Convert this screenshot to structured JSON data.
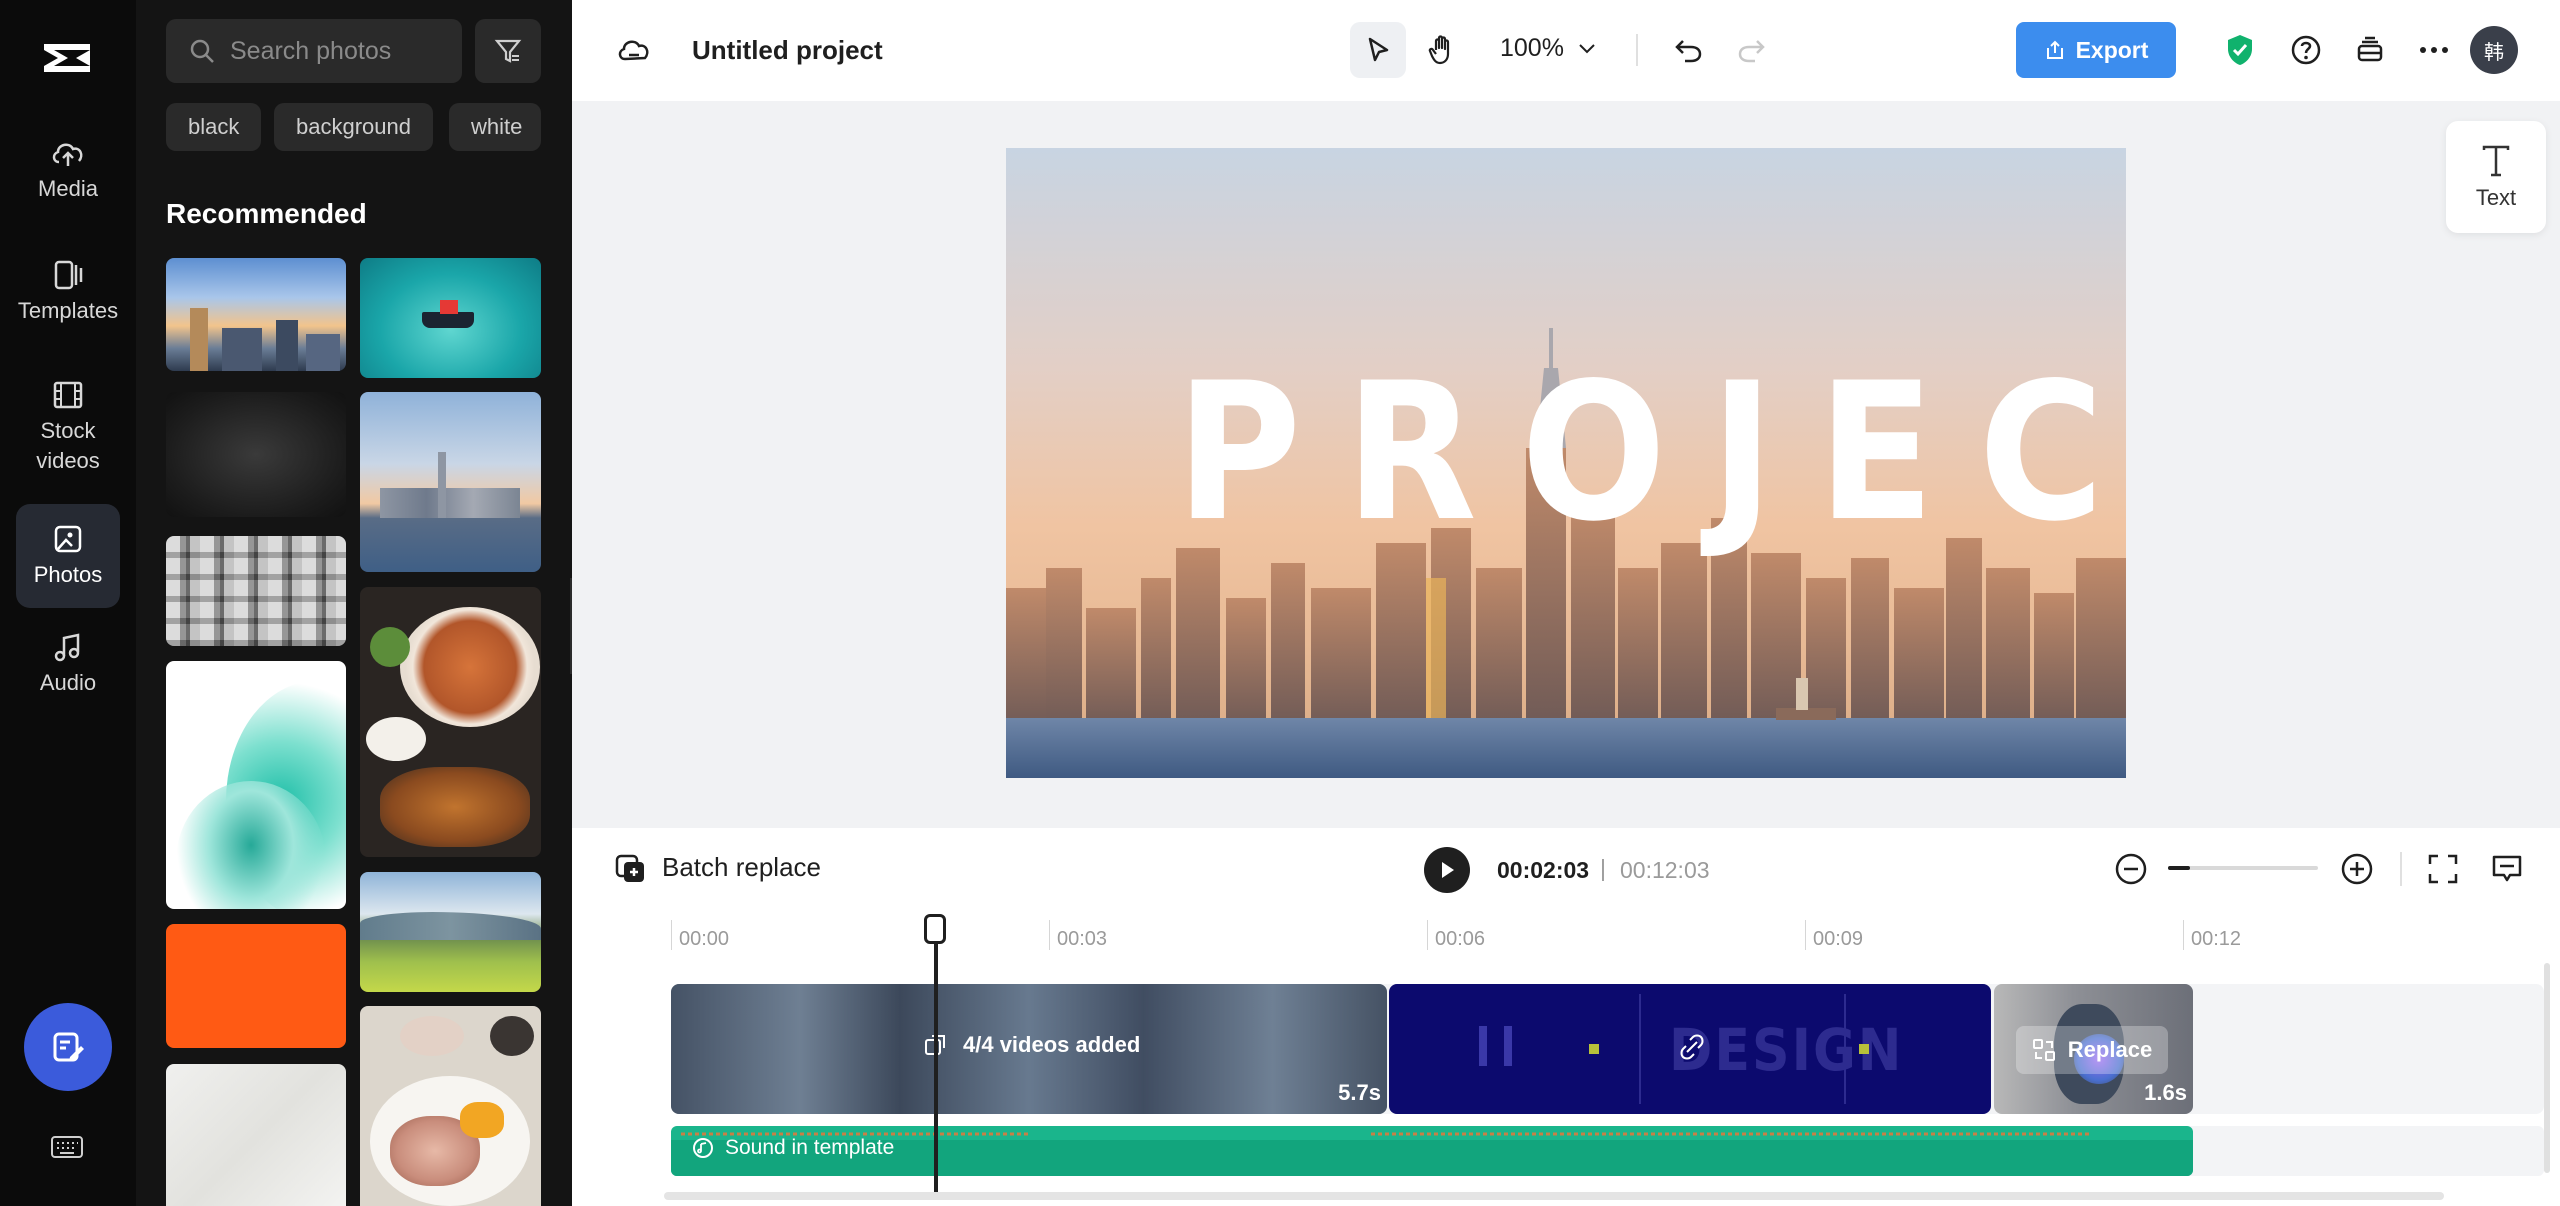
{
  "nav": {
    "items": [
      {
        "label": "Media",
        "icon": "cloud-upload-icon"
      },
      {
        "label": "Templates",
        "icon": "templates-icon"
      },
      {
        "label": "Stock\nvideos",
        "icon": "film-icon"
      },
      {
        "label": "Photos",
        "icon": "image-icon",
        "active": true
      },
      {
        "label": "Audio",
        "icon": "music-note-icon"
      }
    ]
  },
  "panel": {
    "search_placeholder": "Search photos",
    "chips": [
      "black",
      "background",
      "white"
    ],
    "section_title": "Recommended"
  },
  "topbar": {
    "project_title": "Untitled project",
    "zoom": "100%",
    "export_label": "Export",
    "avatar_text": "韩"
  },
  "canvas": {
    "preview_text": "PROJECT",
    "text_tool_label": "Text"
  },
  "timeline": {
    "batch_replace_label": "Batch replace",
    "current_time": "00:02:03",
    "separator": "|",
    "total_time": "00:12:03",
    "ruler": [
      "00:00",
      "00:03",
      "00:06",
      "00:09",
      "00:12"
    ],
    "clips": [
      {
        "label": "4/4 videos added",
        "duration": "5.7s"
      },
      {
        "label": "DESIGN",
        "duration": ""
      },
      {
        "label": "Replace",
        "duration": "1.6s"
      }
    ],
    "audio_label": "Sound in template"
  },
  "colors": {
    "accent": "#3c8dee",
    "audio_track": "#1ab58c",
    "rail_bg": "#0b0b0b",
    "panel_bg": "#141414"
  }
}
